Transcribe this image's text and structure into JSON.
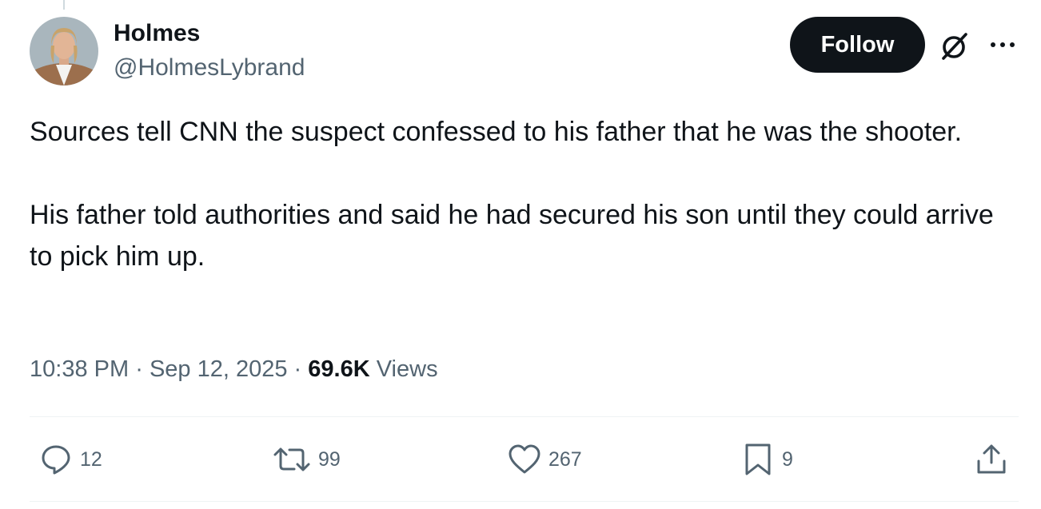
{
  "author": {
    "display_name": "Holmes",
    "handle": "@HolmesLybrand"
  },
  "header": {
    "follow_label": "Follow"
  },
  "tweet": {
    "paragraphs": [
      "Sources tell CNN the suspect confessed to his father that he was the shooter.",
      "His father told authorities and said he had secured his son until they could arrive to pick him up."
    ]
  },
  "meta": {
    "time": "10:38 PM",
    "separator": "·",
    "date": "Sep 12, 2025",
    "views_count": "69.6K",
    "views_label": "Views"
  },
  "actions": {
    "replies": "12",
    "reposts": "99",
    "likes": "267",
    "bookmarks": "9"
  },
  "icons": {
    "reply": "reply-icon",
    "repost": "repost-icon",
    "like": "heart-icon",
    "bookmark": "bookmark-icon",
    "share": "share-icon",
    "grok": "grok-icon",
    "more": "more-icon"
  },
  "colors": {
    "text_primary": "#0f1419",
    "text_secondary": "#536471",
    "divider": "#eff3f4",
    "follow_bg": "#0f1419"
  }
}
